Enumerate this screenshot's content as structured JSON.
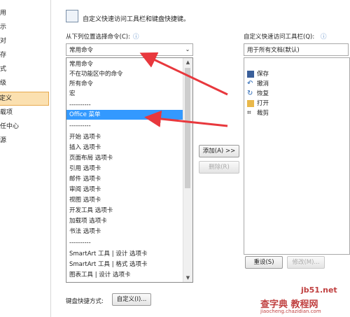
{
  "sidebar": {
    "items": [
      {
        "label": "用"
      },
      {
        "label": "示"
      },
      {
        "label": "对"
      },
      {
        "label": "存"
      },
      {
        "label": "式"
      },
      {
        "label": "级"
      },
      {
        "label": "定义"
      },
      {
        "label": "载项"
      },
      {
        "label": "任中心"
      },
      {
        "label": "源"
      }
    ]
  },
  "header": {
    "title": "自定义快速访问工具栏和键盘快捷键。"
  },
  "left": {
    "label": "从下列位置选择命令(C):",
    "combo_value": "常用命令",
    "dropdown_items": [
      "常用命令",
      "不在功能区中的命令",
      "所有命令",
      "宏",
      "----------",
      "Office 菜单",
      "----------",
      "开始 选项卡",
      "插入 选项卡",
      "页面布局 选项卡",
      "引用 选项卡",
      "邮件 选项卡",
      "审阅 选项卡",
      "视图 选项卡",
      "开发工具 选项卡",
      "加载项 选项卡",
      "书法 选项卡",
      "----------",
      "SmartArt 工具 | 设计 选项卡",
      "SmartArt 工具 | 格式 选项卡",
      "图表工具 | 设计 选项卡"
    ],
    "selected_index": 5
  },
  "right": {
    "label": "自定义快速访问工具栏(Q):",
    "combo_value": "用于所有文档(默认)",
    "items": [
      "保存",
      "撤消",
      "恢复",
      "打开",
      "裁剪"
    ]
  },
  "buttons": {
    "add": "添加(A) >>",
    "remove": "删除(R)",
    "reset": "重设(S)",
    "modify": "修改(M)...",
    "customize": "自定义(I)..."
  },
  "keyboard_label": "键盘快捷方式:",
  "watermark": {
    "line1": "jb51.net",
    "line2": "查字典 教程网",
    "line3": "jiaocheng.chazidian.com"
  },
  "colors": {
    "selection": "#3399ff",
    "arrow": "#e8383d",
    "active_nav": "#fbe0b0"
  }
}
